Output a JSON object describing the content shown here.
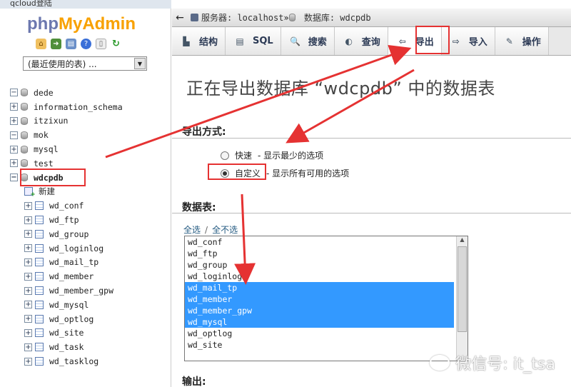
{
  "window": {
    "title": "qcloud登陆"
  },
  "logo": {
    "php": "php",
    "my": "My",
    "admin": "Admin"
  },
  "quick_icons": [
    "home-icon",
    "exit-icon",
    "sql-icon",
    "help-icon",
    "doc-icon",
    "refresh-icon"
  ],
  "recent": {
    "label": "(最近使用的表) ..."
  },
  "tree": {
    "databases": [
      {
        "name": "dede",
        "toggle": "−"
      },
      {
        "name": "information_schema",
        "toggle": "+"
      },
      {
        "name": "itzixun",
        "toggle": "+"
      },
      {
        "name": "mok",
        "toggle": "−"
      },
      {
        "name": "mysql",
        "toggle": "+"
      },
      {
        "name": "test",
        "toggle": "+"
      },
      {
        "name": "wdcpdb",
        "toggle": "−"
      }
    ],
    "new_label": "新建",
    "tables": [
      "wd_conf",
      "wd_ftp",
      "wd_group",
      "wd_loginlog",
      "wd_mail_tp",
      "wd_member",
      "wd_member_gpw",
      "wd_mysql",
      "wd_optlog",
      "wd_site",
      "wd_task",
      "wd_tasklog"
    ]
  },
  "breadcrumb": {
    "back": "←",
    "server": "服务器: localhost",
    "sep": "»",
    "database": "数据库: wdcpdb"
  },
  "tabs": [
    {
      "label": "结构",
      "icon": "structure-icon"
    },
    {
      "label": "SQL",
      "icon": "sql-icon"
    },
    {
      "label": "搜索",
      "icon": "search-icon"
    },
    {
      "label": "查询",
      "icon": "query-icon"
    },
    {
      "label": "导出",
      "icon": "export-icon",
      "active": true
    },
    {
      "label": "导入",
      "icon": "import-icon"
    },
    {
      "label": "操作",
      "icon": "wrench-icon"
    }
  ],
  "page": {
    "heading": "正在导出数据库 “wdcpdb” 中的数据表",
    "export_method_title": "导出方式:",
    "quick_label": "快速",
    "quick_desc": "- 显示最少的选项",
    "custom_label": "自定义",
    "custom_desc": "- 显示所有可用的选项",
    "selected_method": "custom",
    "tables_title": "数据表:",
    "select_all": "全选",
    "slash": "/",
    "select_none": "全不选",
    "output_title": "输出:"
  },
  "table_list": [
    {
      "name": "wd_conf",
      "selected": false
    },
    {
      "name": "wd_ftp",
      "selected": false
    },
    {
      "name": "wd_group",
      "selected": false
    },
    {
      "name": "wd_loginlog",
      "selected": false
    },
    {
      "name": "wd_mail_tp",
      "selected": true
    },
    {
      "name": "wd_member",
      "selected": true
    },
    {
      "name": "wd_member_gpw",
      "selected": true
    },
    {
      "name": "wd_mysql",
      "selected": true
    },
    {
      "name": "wd_optlog",
      "selected": false
    },
    {
      "name": "wd_site",
      "selected": false
    }
  ],
  "watermark": {
    "text": "微信号: it_tsa"
  },
  "colors": {
    "accent": "#e53232",
    "selection": "#3399ff",
    "logo_php": "#6c78af",
    "logo_admin": "#f8a100"
  }
}
